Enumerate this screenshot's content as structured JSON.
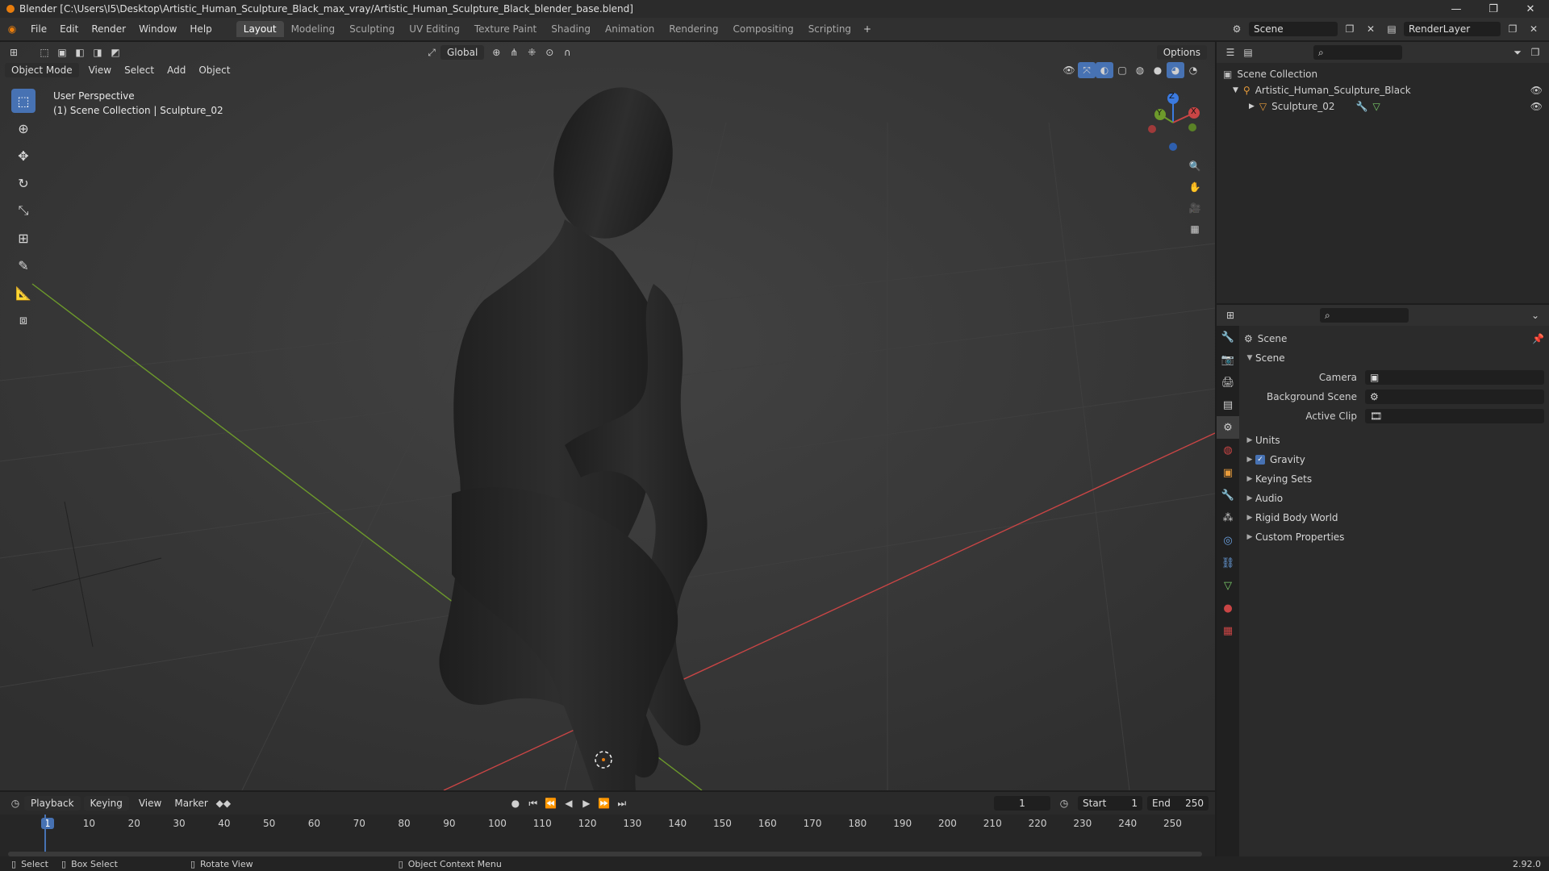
{
  "window": {
    "title": "Blender [C:\\Users\\I5\\Desktop\\Artistic_Human_Sculpture_Black_max_vray/Artistic_Human_Sculpture_Black_blender_base.blend]"
  },
  "menus": [
    "File",
    "Edit",
    "Render",
    "Window",
    "Help"
  ],
  "workspaces": [
    "Layout",
    "Modeling",
    "Sculpting",
    "UV Editing",
    "Texture Paint",
    "Shading",
    "Animation",
    "Rendering",
    "Compositing",
    "Scripting"
  ],
  "scene": {
    "name": "Scene",
    "render_layer": "RenderLayer"
  },
  "viewport": {
    "mode": "Object Mode",
    "menus": [
      "View",
      "Select",
      "Add",
      "Object"
    ],
    "transform": "Global",
    "options": "Options",
    "overlay_line1": "User Perspective",
    "overlay_line2": "(1) Scene Collection | Sculpture_02"
  },
  "gizmo": {
    "x": "X",
    "y": "Y",
    "z": "Z"
  },
  "outliner": {
    "root": "Scene Collection",
    "items": [
      "Artistic_Human_Sculpture_Black",
      "Sculpture_02"
    ]
  },
  "properties": {
    "header": "Scene",
    "section": "Scene",
    "camera_label": "Camera",
    "bg_scene_label": "Background Scene",
    "active_clip_label": "Active Clip",
    "panels": [
      "Units",
      "Gravity",
      "Keying Sets",
      "Audio",
      "Rigid Body World",
      "Custom Properties"
    ]
  },
  "timeline": {
    "menus": [
      "Playback",
      "Keying",
      "View",
      "Marker"
    ],
    "current_frame": "1",
    "start_label": "Start",
    "start": "1",
    "end_label": "End",
    "end": "250",
    "ticks": [
      "1",
      "10",
      "20",
      "30",
      "40",
      "50",
      "60",
      "70",
      "80",
      "90",
      "100",
      "110",
      "120",
      "130",
      "140",
      "150",
      "160",
      "170",
      "180",
      "190",
      "200",
      "210",
      "220",
      "230",
      "240",
      "250"
    ]
  },
  "statusbar": {
    "select": "Select",
    "box_select": "Box Select",
    "rotate": "Rotate View",
    "context": "Object Context Menu",
    "version": "2.92.0"
  },
  "colors": {
    "accent": "#4772b3",
    "x_axis": "#c94545",
    "y_axis": "#6d9a2b",
    "z_axis": "#3b7ae0"
  }
}
